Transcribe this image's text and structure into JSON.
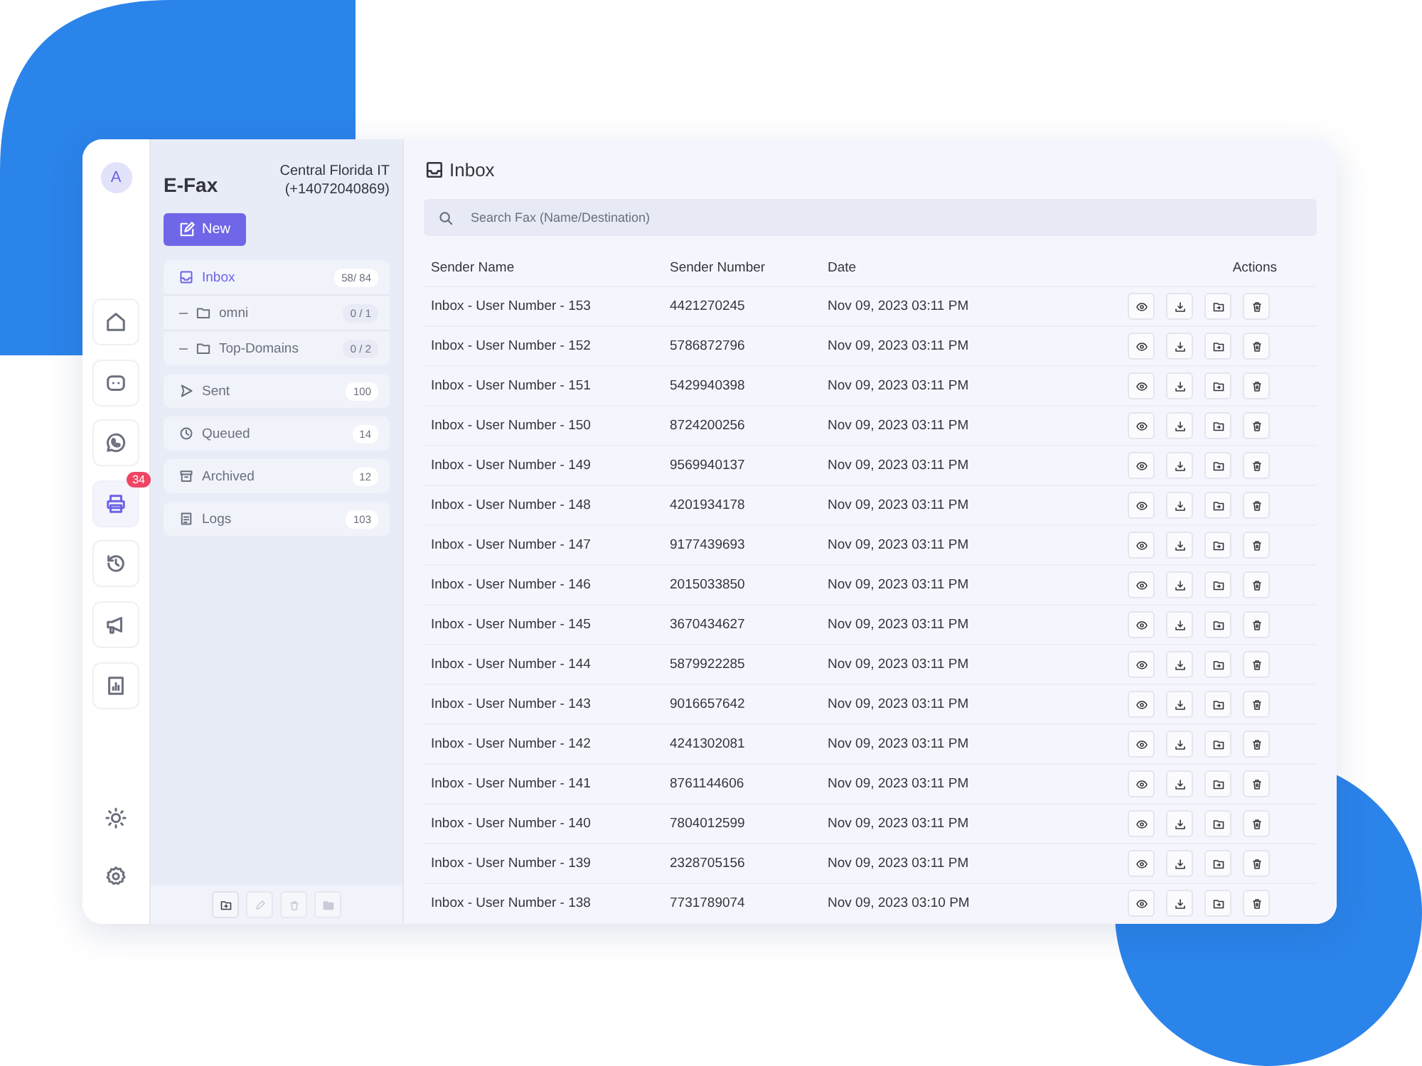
{
  "rail": {
    "avatar": "A",
    "items": [
      {
        "selected": false
      },
      {
        "selected": false
      },
      {
        "selected": false
      },
      {
        "selected": true,
        "badge": "34"
      },
      {
        "selected": false
      },
      {
        "selected": false
      },
      {
        "selected": false
      }
    ]
  },
  "folders": {
    "title": "E-Fax",
    "account": "Central Florida IT",
    "account_number": "(+14072040869)",
    "new_button": "New",
    "items": [
      {
        "label": "Inbox",
        "count": "58/ 84",
        "selected": true,
        "children": [
          {
            "label": "omni",
            "count": "0 / 1"
          },
          {
            "label": "Top-Domains",
            "count": "0 / 2"
          }
        ]
      },
      {
        "label": "Sent",
        "count": "100",
        "selected": false
      },
      {
        "label": "Queued",
        "count": "14",
        "selected": false
      },
      {
        "label": "Archived",
        "count": "12",
        "selected": false
      },
      {
        "label": "Logs",
        "count": "103",
        "selected": false
      }
    ],
    "toolbar": [
      {
        "disabled": false
      },
      {
        "disabled": true
      },
      {
        "disabled": true
      },
      {
        "disabled": true
      }
    ]
  },
  "inbox": {
    "title": "Inbox",
    "search": {
      "placeholder": "Search Fax (Name/Destination)"
    },
    "table": {
      "columns": [
        "Sender Name",
        "Sender Number",
        "Date",
        "Actions"
      ],
      "rows": [
        [
          "Inbox - User Number - 153",
          "4421270245",
          "Nov 09, 2023 03:11 PM"
        ],
        [
          "Inbox - User Number - 152",
          "5786872796",
          "Nov 09, 2023 03:11 PM"
        ],
        [
          "Inbox - User Number - 151",
          "5429940398",
          "Nov 09, 2023 03:11 PM"
        ],
        [
          "Inbox - User Number - 150",
          "8724200256",
          "Nov 09, 2023 03:11 PM"
        ],
        [
          "Inbox - User Number - 149",
          "9569940137",
          "Nov 09, 2023 03:11 PM"
        ],
        [
          "Inbox - User Number - 148",
          "4201934178",
          "Nov 09, 2023 03:11 PM"
        ],
        [
          "Inbox - User Number - 147",
          "9177439693",
          "Nov 09, 2023 03:11 PM"
        ],
        [
          "Inbox - User Number - 146",
          "2015033850",
          "Nov 09, 2023 03:11 PM"
        ],
        [
          "Inbox - User Number - 145",
          "3670434627",
          "Nov 09, 2023 03:11 PM"
        ],
        [
          "Inbox - User Number - 144",
          "5879922285",
          "Nov 09, 2023 03:11 PM"
        ],
        [
          "Inbox - User Number - 143",
          "9016657642",
          "Nov 09, 2023 03:11 PM"
        ],
        [
          "Inbox - User Number - 142",
          "4241302081",
          "Nov 09, 2023 03:11 PM"
        ],
        [
          "Inbox - User Number - 141",
          "8761144606",
          "Nov 09, 2023 03:11 PM"
        ],
        [
          "Inbox - User Number - 140",
          "7804012599",
          "Nov 09, 2023 03:11 PM"
        ],
        [
          "Inbox - User Number - 139",
          "2328705156",
          "Nov 09, 2023 03:11 PM"
        ],
        [
          "Inbox - User Number - 138",
          "7731789074",
          "Nov 09, 2023 03:10 PM"
        ]
      ]
    }
  }
}
